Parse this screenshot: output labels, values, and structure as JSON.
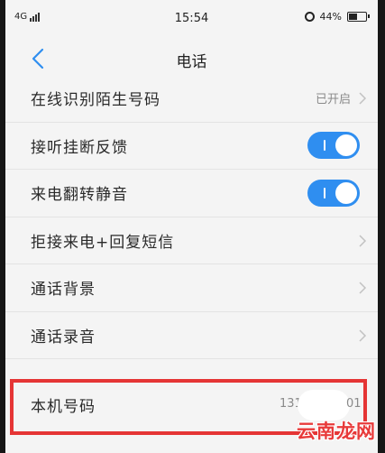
{
  "status_bar": {
    "network": "4G",
    "time": "15:54",
    "battery": "44%",
    "battery_level": 0.44
  },
  "nav": {
    "title": "电话"
  },
  "rows": [
    {
      "label": "在线识别陌生号码",
      "value": "已开启"
    },
    {
      "label": "接听挂断反馈",
      "toggle": "on"
    },
    {
      "label": "来电翻转静音",
      "toggle": "on"
    },
    {
      "label": "拒接来电+回复短信"
    },
    {
      "label": "通话背景"
    },
    {
      "label": "通话录音"
    }
  ],
  "phone_number": {
    "label": "本机号码",
    "value_start": "131",
    "value_end": "01"
  },
  "watermark": "云南龙网",
  "colors": {
    "accent": "#2f8ef0",
    "highlight": "#e53535"
  }
}
